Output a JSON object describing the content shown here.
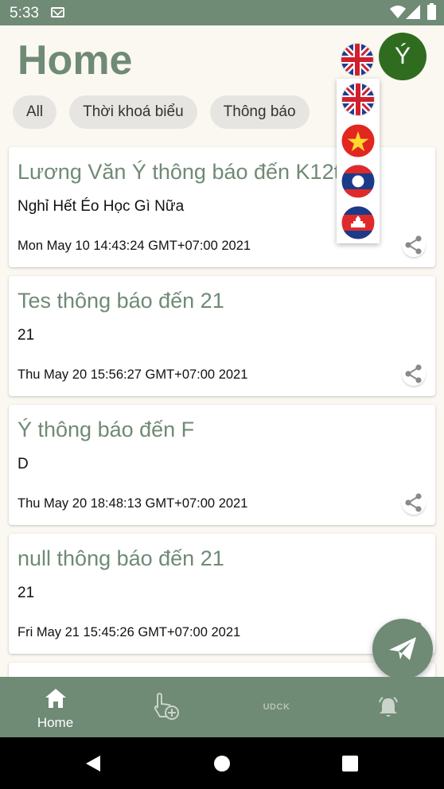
{
  "status": {
    "time": "5:33"
  },
  "header": {
    "title": "Home",
    "avatar_letter": "Ý",
    "current_language": "English"
  },
  "chips": [
    "All",
    "Thời khoá biểu",
    "Thông báo"
  ],
  "languages": [
    "English",
    "Vietnamese",
    "Lao",
    "Khmer"
  ],
  "cards": [
    {
      "title": "Lương Văn Ý thông báo đến K12tt",
      "body": "Nghỉ Hết Éo Học Gì Nữa",
      "date": "Mon May 10 14:43:24 GMT+07:00 2021"
    },
    {
      "title": "Tes thông báo đến 21",
      "body": "21",
      "date": "Thu May 20 15:56:27 GMT+07:00 2021"
    },
    {
      "title": "Ý thông báo đến F",
      "body": "D",
      "date": "Thu May 20 18:48:13 GMT+07:00 2021"
    },
    {
      "title": "null thông báo đến 21",
      "body": "21",
      "date": "Fri May 21 15:45:26 GMT+07:00 2021"
    }
  ],
  "nav": {
    "home_label": "Home",
    "udck_text": "UDCK"
  },
  "icons": {
    "fab": "send-icon",
    "nav": [
      "home-icon",
      "touch-add-icon",
      "udck-logo",
      "bell-icon"
    ],
    "share": "share-icon"
  },
  "colors": {
    "primary": "#6f8a75",
    "avatar": "#2f6c1f",
    "background": "#fbf8f2"
  }
}
